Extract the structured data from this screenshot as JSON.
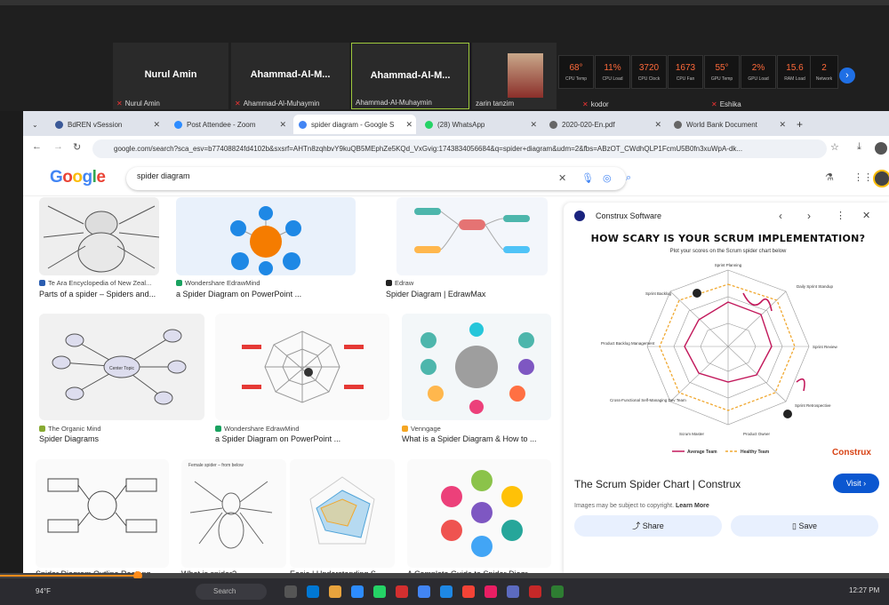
{
  "zoom": {
    "tiles": [
      {
        "name": "Nurul Amin",
        "caption": "Nurul Amin"
      },
      {
        "name": "Ahammad-Al-M...",
        "caption": "Ahammad-Al-Muhaymin"
      },
      {
        "name": "Ahammad-Al-M...",
        "caption": "Ahammad-Al-Muhaymin"
      }
    ],
    "video_caption": "zarin tanzim",
    "extra_captions": [
      "kodor",
      "Eshika"
    ],
    "gauges": [
      {
        "value": "68°",
        "label": "CPU Temp"
      },
      {
        "value": "11%",
        "label": "CPU Load"
      },
      {
        "value": "3720",
        "label": "CPU Clock"
      },
      {
        "value": "1673",
        "label": "CPU Fan"
      },
      {
        "value": "55°",
        "label": "GPU Temp"
      },
      {
        "value": "2%",
        "label": "GPU Load"
      },
      {
        "value": "15.6",
        "label": "RAM Load"
      },
      {
        "value": "2",
        "label": "Network"
      }
    ]
  },
  "browser": {
    "tabs": [
      {
        "label": "BdREN vSession",
        "color": "#3b5998"
      },
      {
        "label": "Post Attendee - Zoom",
        "color": "#2d8cff"
      },
      {
        "label": "spider diagram - Google S",
        "color": "#4285f4"
      },
      {
        "label": "(28) WhatsApp",
        "color": "#25d366"
      },
      {
        "label": "2020-020-En.pdf",
        "color": "#666666"
      },
      {
        "label": "World Bank Document",
        "color": "#666666"
      }
    ],
    "url": "google.com/search?sca_esv=b77408824fd4102b&sxsrf=AHTn8zqhbvY9kuQB5MEphZe5KQd_VxGvig:1743834056684&q=spider+diagram&udm=2&fbs=ABzOT_CWdhQLP1FcmU5B0fn3xuWpA-dk...",
    "logo": "Google",
    "query": "spider diagram"
  },
  "results": [
    {
      "source": "Te Ara Encyclopedia of New Zeal...",
      "title": "Parts of a spider – Spiders and...",
      "color": "#2a5db0"
    },
    {
      "source": "Wondershare EdrawMind",
      "title": "a Spider Diagram on PowerPoint ...",
      "color": "#1aa260"
    },
    {
      "source": "Edraw",
      "title": "Spider Diagram | EdrawMax",
      "color": "#222222"
    },
    {
      "source": "The Organic Mind",
      "title": "Spider Diagrams",
      "color": "#88aa33"
    },
    {
      "source": "Wondershare EdrawMind",
      "title": "a Spider Diagram on PowerPoint ...",
      "color": "#1aa260"
    },
    {
      "source": "Venngage",
      "title": "What is a Spider Diagram & How to ...",
      "color": "#f5a623"
    }
  ],
  "thumb_labels": {
    "center_topic": "Center Topic",
    "female_spider": "Female spider – from below",
    "bottom_row": [
      "Spider Diagram Outline Rectang...",
      "What is spider?",
      "Easie | Understanding S...",
      "A Complete Guide to Spider Diagr..."
    ]
  },
  "panel": {
    "site": "Construx Software",
    "image_title": "HOW SCARY IS YOUR SCRUM IMPLEMENTATION?",
    "image_subtitle": "Plot your scores on the Scrum spider chart below",
    "axis_labels": [
      "Sprint Planning",
      "Daily Sprint Standup",
      "Sprint Review",
      "Sprint Retrospective",
      "Product Owner",
      "Scrum Master",
      "Cross-Functional Self-Managing Dev Team",
      "Product Backlog Management",
      "Sprint Backlog"
    ],
    "legend": [
      "Average Team",
      "Healthy Team"
    ],
    "brand": "Construx",
    "title": "The Scrum Spider Chart | Construx",
    "visit": "Visit ›",
    "copyright": "Images may be subject to copyright.",
    "learn_more": "Learn More",
    "share": "Share",
    "save": "Save"
  },
  "taskbar": {
    "weather": "94°F",
    "search": "Search",
    "time": "12:27 PM"
  }
}
